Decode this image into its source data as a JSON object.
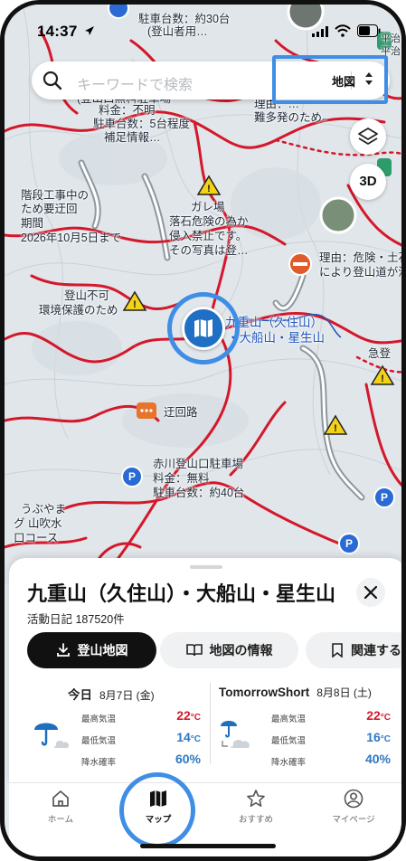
{
  "status_bar": {
    "time": "14:37"
  },
  "search": {
    "placeholder": "キーワードで検索",
    "map_type": "地図"
  },
  "map_controls": {
    "btn_3d": "3D"
  },
  "map_labels": {
    "parking_top": "駐車台数：約30台",
    "parking_top2": "(登山者用…",
    "parking_left_1": "(登山口無料駐車場",
    "parking_left_2": "料金：不明",
    "parking_left_3": "駐車台数：5台程度",
    "parking_left_4": "補足情報…",
    "right_top_1": "理由：…",
    "right_top_2": "難多発のため。",
    "right_edge_1": "平治",
    "right_edge_2": "平治",
    "stairs_1": "階段工事中の",
    "stairs_2": "ため要迂回",
    "stairs_3": "期間",
    "stairs_4": "2026年10月5日まで",
    "gareba_1": "ガレ場",
    "gareba_2": "落石危険の為か",
    "gareba_3": "侵入禁止です。",
    "gareba_4": "その写真は登…",
    "danger_1": "理由：危険・土石",
    "danger_2": "により登山道が消",
    "closed_1": "登山不可",
    "closed_2": "環境保護のため",
    "mountain_1": "九重山（久住山）",
    "mountain_2": "・大船山・星生山",
    "steep": "急登",
    "detour": "迂回路",
    "akagawa_1": "赤川登山口駐車場",
    "akagawa_2": "料金：無料",
    "akagawa_3": "駐車台数：約40台",
    "left_bottom_1": "うぶやま",
    "left_bottom_2": "グ 山吹水",
    "left_bottom_3": "口コース"
  },
  "sheet": {
    "title": "九重山（久住山）・大船山・星生山",
    "activity": "活動日記 187520件",
    "btn_climb_map": "登山地図",
    "btn_map_info": "地図の情報",
    "btn_related": "関連する"
  },
  "weather": {
    "today": {
      "label": "今日",
      "date": "8月7日 (金)",
      "max_label": "最高気温",
      "max": "22",
      "min_label": "最低気温",
      "min": "14",
      "rain_label": "降水確率",
      "rain": "60%"
    },
    "tomorrow": {
      "label": "TomorrowShort",
      "date": "8月8日 (土)",
      "max_label": "最高気温",
      "max": "22",
      "min_label": "最低気温",
      "min": "16",
      "rain_label": "降水確率",
      "rain": "40%"
    },
    "unit": "°C"
  },
  "tabs": [
    {
      "label": "ホーム",
      "icon": "home-icon"
    },
    {
      "label": "マップ",
      "icon": "map-icon"
    },
    {
      "label": "おすすめ",
      "icon": "star-icon"
    },
    {
      "label": "マイページ",
      "icon": "user-icon"
    }
  ],
  "colors": {
    "accent": "#3e8ee6",
    "route": "#d4182b",
    "trail_blue": "#1f55b8",
    "temp_high": "#d4182b",
    "temp_low": "#2e78c2"
  }
}
